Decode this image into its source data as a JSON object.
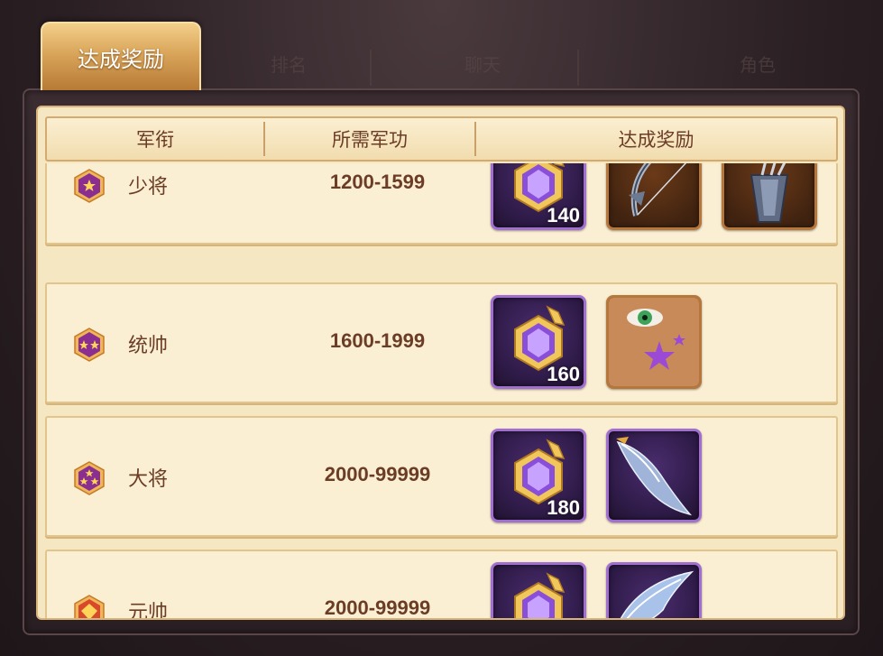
{
  "tabs": [
    {
      "label": "达成奖励",
      "active": true
    },
    {
      "label": "排名",
      "active": false
    },
    {
      "label": "聊天",
      "active": false
    },
    {
      "label": "角色",
      "active": false
    }
  ],
  "table": {
    "headers": [
      "军衔",
      "所需军功",
      "达成奖励"
    ],
    "rows": [
      {
        "rank": "少将",
        "merit": "1200-1599",
        "stars": 1,
        "rewards": [
          {
            "icon": "purple-gem-icon",
            "quantity": "140"
          },
          {
            "icon": "bow-icon",
            "quantity": ""
          },
          {
            "icon": "quiver-icon",
            "quantity": ""
          }
        ]
      },
      {
        "rank": "统帅",
        "merit": "1600-1999",
        "stars": 2,
        "rewards": [
          {
            "icon": "purple-gem-icon",
            "quantity": "160"
          },
          {
            "icon": "face-star-tattoo-icon",
            "quantity": ""
          }
        ]
      },
      {
        "rank": "大将",
        "merit": "2000-99999",
        "stars": 3,
        "rewards": [
          {
            "icon": "purple-gem-icon",
            "quantity": "180"
          },
          {
            "icon": "feather-wing-icon",
            "quantity": ""
          }
        ]
      },
      {
        "rank": "元帅",
        "merit": "2000-99999",
        "stars": 0,
        "rewards": [
          {
            "icon": "purple-gem-icon",
            "quantity": ""
          },
          {
            "icon": "wing-icon",
            "quantity": ""
          }
        ]
      }
    ]
  },
  "colors": {
    "text_brown": "#6b3c26",
    "row_bg": "#fbefd3",
    "gem_purple": "#a06fd0",
    "badge_purple": "#8a2f8f"
  }
}
